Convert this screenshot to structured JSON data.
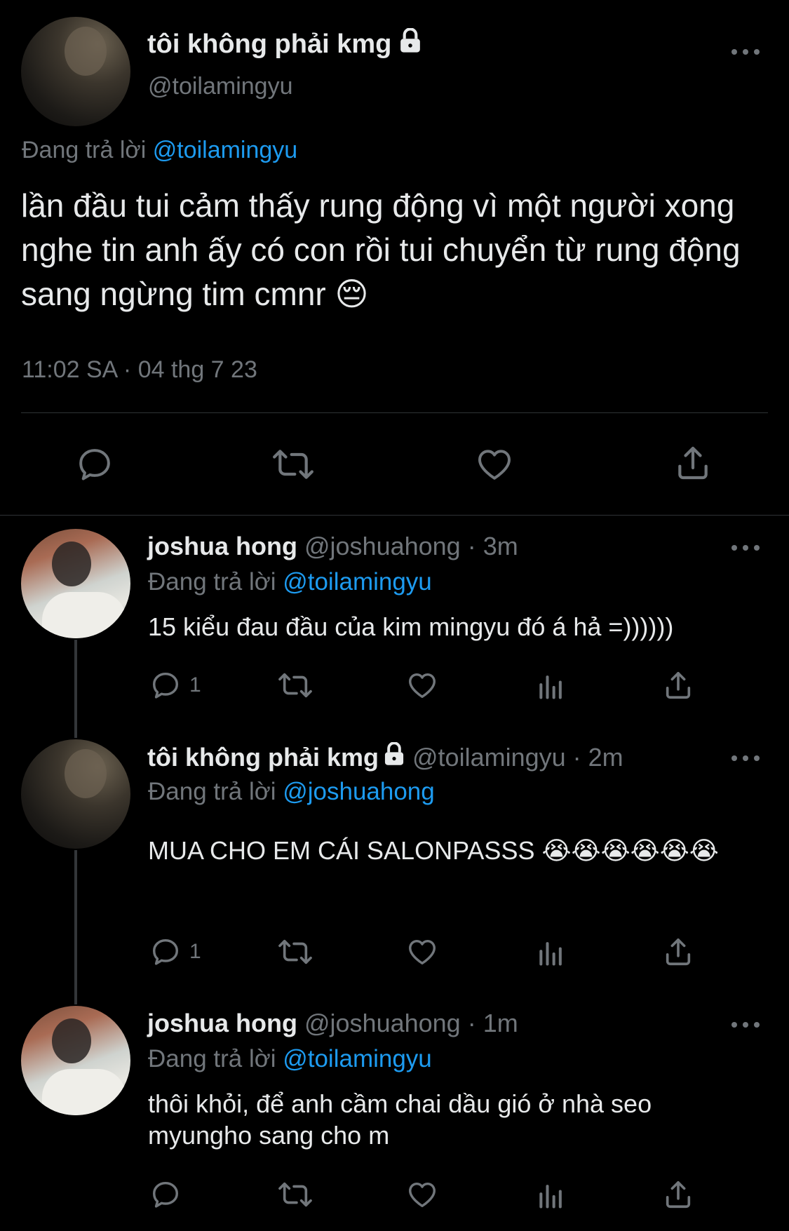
{
  "main_tweet": {
    "display_name": "tôi không phải kmg",
    "locked_icon": "lock-icon",
    "handle": "@toilamingyu",
    "replying_prefix": "Đang trả lời",
    "replying_to": "@toilamingyu",
    "text": "lần đầu tui cảm thấy rung động vì một người xong nghe tin anh ấy có con rồi tui chuyển từ rung động sang ngừng tim cmnr 😔",
    "timestamp": "11:02 SA · 04 thg 7 23",
    "actions": [
      "reply-icon",
      "retweet-icon",
      "like-icon",
      "share-icon"
    ]
  },
  "replies": [
    {
      "display_name": "joshua hong",
      "handle": "@joshuahong",
      "time": "· 3m",
      "replying_prefix": "Đang trả lời",
      "replying_to": "@toilamingyu",
      "text": "15 kiểu đau đầu của kim mingyu đó á hả =))))))",
      "reply_count": "1"
    },
    {
      "display_name": "tôi không phải kmg",
      "locked": true,
      "handle": "@toilamingyu",
      "time": "· 2m",
      "replying_prefix": "Đang trả lời",
      "replying_to": "@joshuahong",
      "text": "MUA CHO EM CÁI SALONPASSS 😭😭😭😭😭😭",
      "reply_count": "1"
    },
    {
      "display_name": "joshua hong",
      "handle": "@joshuahong",
      "time": "· 1m",
      "replying_prefix": "Đang trả lời",
      "replying_to": "@toilamingyu",
      "text": "thôi khỏi, để anh cầm chai dầu gió ở nhà seo myungho sang cho m",
      "reply_count": ""
    }
  ],
  "colors": {
    "background": "#000000",
    "text": "#e7e9ea",
    "muted": "#71767b",
    "link": "#1d9bf0",
    "divider": "#2f3336"
  }
}
